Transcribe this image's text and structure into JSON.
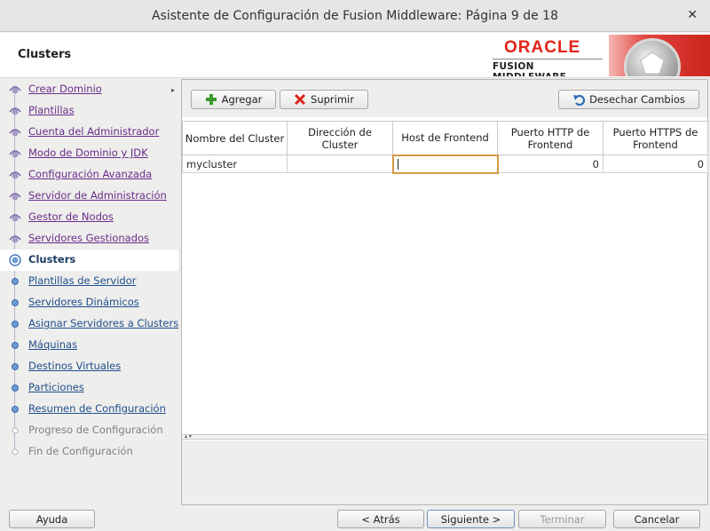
{
  "window": {
    "title": "Asistente de Configuración de Fusion Middleware: Página 9 de 18",
    "close_glyph": "✕"
  },
  "header": {
    "page_title": "Clusters",
    "logo_brand": "ORACLE",
    "logo_product": "FUSION MIDDLEWARE"
  },
  "sidebar": {
    "items": [
      {
        "label": "Crear Dominio",
        "state": "done"
      },
      {
        "label": "Plantillas",
        "state": "done"
      },
      {
        "label": "Cuenta del Administrador",
        "state": "done"
      },
      {
        "label": "Modo de Dominio y JDK",
        "state": "done"
      },
      {
        "label": "Configuración Avanzada",
        "state": "done"
      },
      {
        "label": "Servidor de Administración",
        "state": "done"
      },
      {
        "label": "Gestor de Nodos",
        "state": "done"
      },
      {
        "label": "Servidores Gestionados",
        "state": "done"
      },
      {
        "label": "Clusters",
        "state": "current"
      },
      {
        "label": "Plantillas de Servidor",
        "state": "pending"
      },
      {
        "label": "Servidores Dinámicos",
        "state": "pending"
      },
      {
        "label": "Asignar Servidores a Clusters",
        "state": "pending"
      },
      {
        "label": "Máquinas",
        "state": "pending"
      },
      {
        "label": "Destinos Virtuales",
        "state": "pending"
      },
      {
        "label": "Particiones",
        "state": "pending"
      },
      {
        "label": "Resumen de Configuración",
        "state": "pending"
      },
      {
        "label": "Progreso de Configuración",
        "state": "disabled"
      },
      {
        "label": "Fin de Configuración",
        "state": "disabled"
      }
    ]
  },
  "toolbar": {
    "add_label": "Agregar",
    "delete_label": "Suprimir",
    "discard_label": "Desechar Cambios"
  },
  "table": {
    "headers": [
      "Nombre del Cluster",
      "Dirección de Cluster",
      "Host de Frontend",
      "Puerto HTTP de Frontend",
      "Puerto HTTPS de Frontend"
    ],
    "rows": [
      {
        "name": "mycluster",
        "address": "",
        "host": "",
        "http_port": "0",
        "https_port": "0"
      }
    ]
  },
  "footer": {
    "help_label": "Ayuda",
    "back_label": "< Atrás",
    "next_label": "Siguiente >",
    "finish_label": "Terminar",
    "cancel_label": "Cancelar"
  },
  "colors": {
    "visited_link": "#6a2c8a",
    "current_item": "#1a3a5f",
    "pending_link": "#1f4e8c",
    "oracle_red": "#e2231a",
    "focus_border": "#d39a45"
  }
}
